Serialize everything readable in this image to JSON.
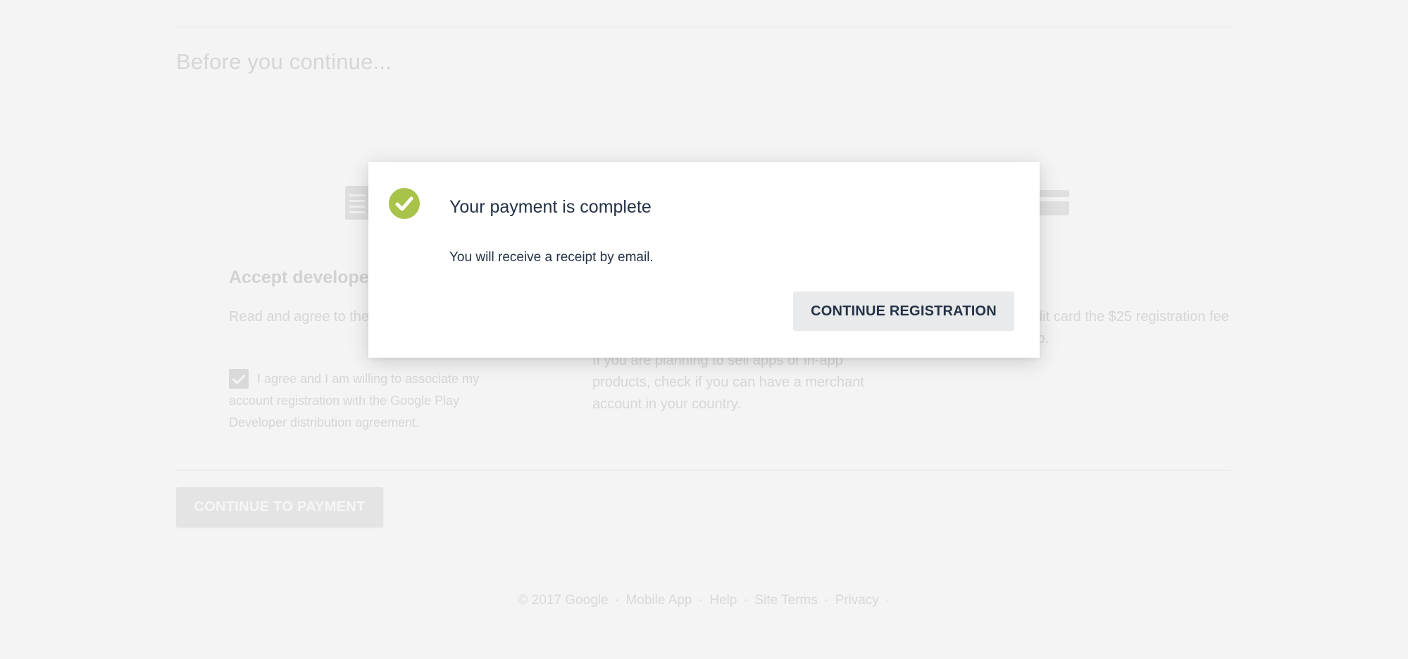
{
  "background": {
    "page_title": "Before you continue...",
    "steps": [
      {
        "heading": "Accept developer",
        "text": "Read and agree to the distribution agreement",
        "checkbox_checked": true,
        "checkbox_label": "I agree and I am willing to associate my account registration with the Google Play Developer distribution agreement."
      },
      {
        "text": "If you are planning to sell apps or in-app products, check if you can have a merchant account in your country."
      },
      {
        "text": "have your credit card the $25 registration fee in the next step."
      }
    ],
    "continue_to_payment_label": "CONTINUE TO PAYMENT"
  },
  "footer": {
    "copyright": "© 2017 Google",
    "links": [
      "Mobile App",
      "Help",
      "Site Terms",
      "Privacy"
    ],
    "separator": "·"
  },
  "modal": {
    "icon": "check-circle-icon",
    "title": "Your payment is complete",
    "body": "You will receive a receipt by email.",
    "continue_button_label": "CONTINUE REGISTRATION"
  },
  "colors": {
    "accent_green": "#a7c34a",
    "text_dark": "#253246",
    "page_bg": "#f4f4f4",
    "button_bg": "#e9eaeb"
  }
}
